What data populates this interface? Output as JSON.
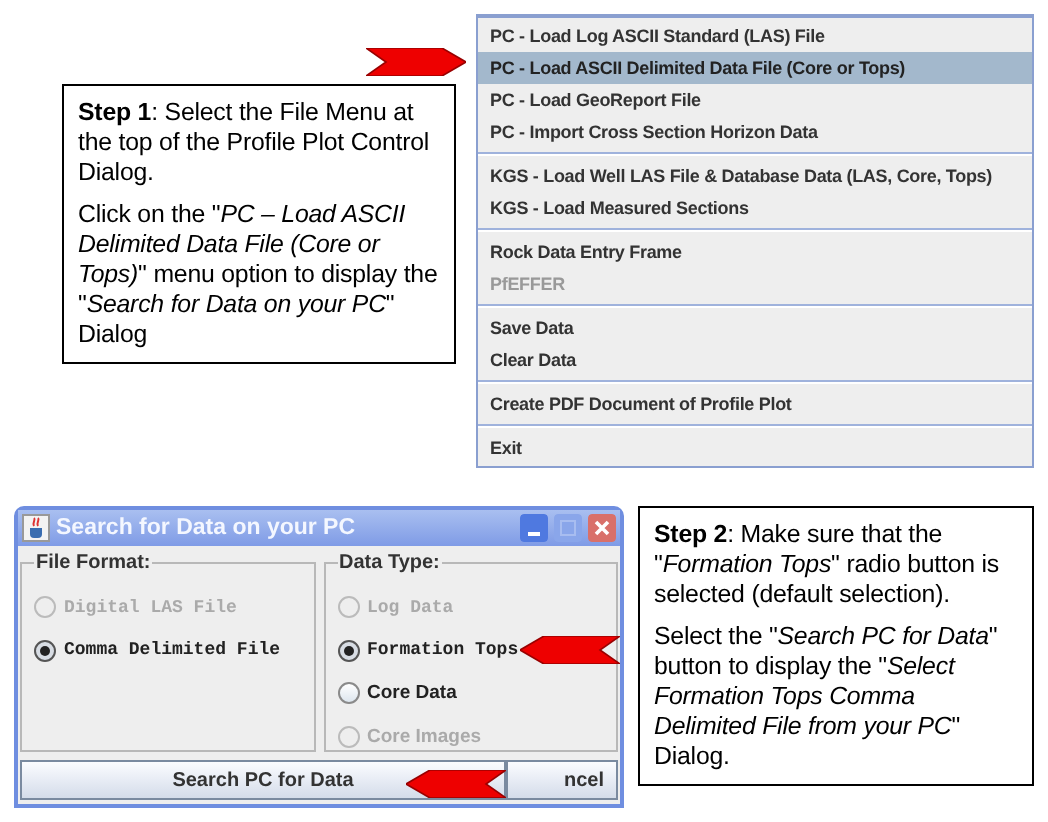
{
  "step1": {
    "paragraphs": [
      "**Step 1**: Select the File Menu at the top of the Profile Plot Control Dialog.",
      "Click on the \"*PC – Load ASCII Delimited Data File  (Core or Tops)*\" menu option to display the \"*Search for Data on your PC*\" Dialog"
    ]
  },
  "menu": {
    "groups": [
      {
        "items": [
          {
            "label": "PC  - Load Log ASCII Standard (LAS) File",
            "selected": false,
            "disabled": false
          },
          {
            "label": "PC  - Load ASCII Delimited Data File (Core or Tops)",
            "selected": true,
            "disabled": false
          },
          {
            "label": "PC  - Load GeoReport File",
            "selected": false,
            "disabled": false
          },
          {
            "label": "PC  - Import Cross Section Horizon Data",
            "selected": false,
            "disabled": false
          }
        ]
      },
      {
        "items": [
          {
            "label": "KGS - Load Well LAS File & Database Data (LAS, Core, Tops)",
            "selected": false,
            "disabled": false
          },
          {
            "label": "KGS - Load Measured Sections",
            "selected": false,
            "disabled": false
          }
        ]
      },
      {
        "items": [
          {
            "label": "Rock Data Entry Frame",
            "selected": false,
            "disabled": false
          },
          {
            "label": "PfEFFER",
            "selected": false,
            "disabled": true
          }
        ]
      },
      {
        "items": [
          {
            "label": "Save Data",
            "selected": false,
            "disabled": false
          },
          {
            "label": "Clear Data",
            "selected": false,
            "disabled": false
          }
        ]
      },
      {
        "items": [
          {
            "label": "Create PDF Document of Profile Plot",
            "selected": false,
            "disabled": false
          }
        ]
      },
      {
        "items": [
          {
            "label": "Exit",
            "selected": false,
            "disabled": false
          }
        ]
      }
    ]
  },
  "dialog": {
    "title": "Search for Data on your PC",
    "file_format": {
      "legend": "File Format:",
      "options": [
        {
          "label": "Digital LAS File",
          "kind": "mono",
          "selected": false,
          "disabled": true
        },
        {
          "label": "Comma Delimited File",
          "kind": "mono",
          "selected": true,
          "disabled": false
        }
      ]
    },
    "data_type": {
      "legend": "Data Type:",
      "options": [
        {
          "label": "Log Data",
          "kind": "mono",
          "selected": false,
          "disabled": true
        },
        {
          "label": "Formation Tops",
          "kind": "mono",
          "selected": true,
          "disabled": false
        },
        {
          "label": "Core Data",
          "kind": "sans",
          "selected": false,
          "disabled": false
        },
        {
          "label": "Core Images",
          "kind": "sans",
          "selected": false,
          "disabled": true
        }
      ]
    },
    "buttons": [
      "Search PC for Data",
      "ncel"
    ]
  },
  "step2": {
    "paragraphs": [
      "**Step 2**:  Make sure that the \"*Formation Tops*\" radio button is selected (default selection).",
      "Select the \"*Search PC for Data*\" button to display the \"*Select Formation Tops Comma Delimited File from your PC*\" Dialog."
    ]
  }
}
